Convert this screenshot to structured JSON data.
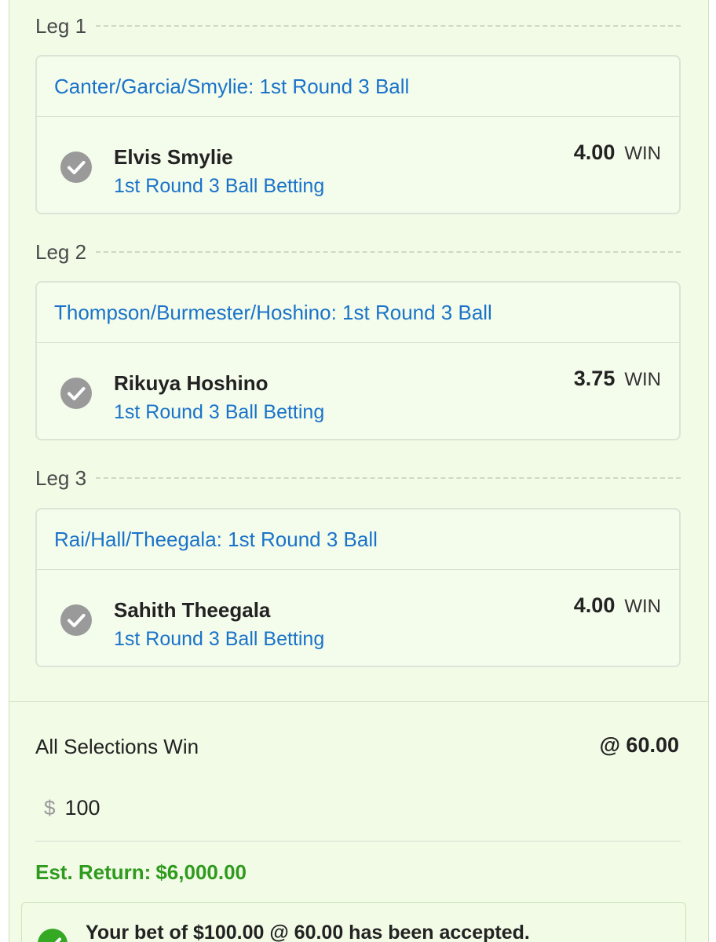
{
  "legs": [
    {
      "leg_label": "Leg 1",
      "market_title": "Canter/Garcia/Smylie: 1st Round 3 Ball",
      "selection_name": "Elvis Smylie",
      "market_name": "1st Round 3 Ball Betting",
      "odds": "4.00",
      "bet_type": "WIN"
    },
    {
      "leg_label": "Leg 2",
      "market_title": "Thompson/Burmester/Hoshino: 1st Round 3 Ball",
      "selection_name": "Rikuya Hoshino",
      "market_name": "1st Round 3 Ball Betting",
      "odds": "3.75",
      "bet_type": "WIN"
    },
    {
      "leg_label": "Leg 3",
      "market_title": "Rai/Hall/Theegala: 1st Round 3 Ball",
      "selection_name": "Sahith Theegala",
      "market_name": "1st Round 3 Ball Betting",
      "odds": "4.00",
      "bet_type": "WIN"
    }
  ],
  "summary": {
    "label": "All Selections Win",
    "combined_odds": "@ 60.00"
  },
  "stake": {
    "currency_symbol": "$",
    "value": "100"
  },
  "est_return": {
    "label": "Est. Return:",
    "value": "$6,000.00"
  },
  "confirmation": {
    "message": "Your bet of $100.00 @ 60.00 has been accepted."
  },
  "colors": {
    "panel_background": "#f1fbe6",
    "link_blue": "#1a73c9",
    "success_green": "#2f9a1e",
    "check_grey": "#9a9a9a"
  },
  "icons": {
    "selection_status": "checkmark-circle-icon",
    "accepted_status": "checkmark-circle-icon"
  }
}
